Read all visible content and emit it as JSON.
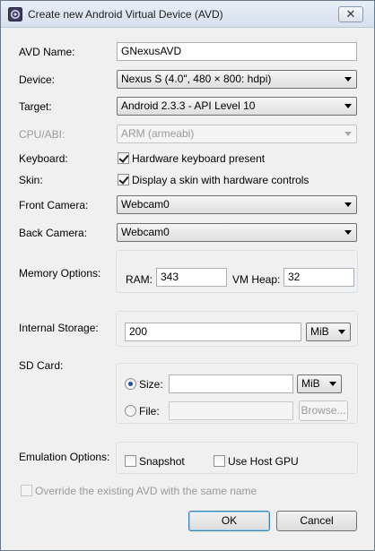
{
  "window": {
    "title": "Create new Android Virtual Device (AVD)",
    "close_symbol": "✕"
  },
  "form": {
    "avd_name": {
      "label": "AVD Name:",
      "value": "GNexusAVD"
    },
    "device": {
      "label": "Device:",
      "value": "Nexus S (4.0\", 480 × 800: hdpi)"
    },
    "target": {
      "label": "Target:",
      "value": "Android 2.3.3 - API Level 10"
    },
    "cpu_abi": {
      "label": "CPU/ABI:",
      "value": "ARM (armeabi)",
      "enabled": false
    },
    "keyboard": {
      "label": "Keyboard:",
      "checkbox_label": "Hardware keyboard present",
      "checked": true
    },
    "skin": {
      "label": "Skin:",
      "checkbox_label": "Display a skin with hardware controls",
      "checked": true
    },
    "front_camera": {
      "label": "Front Camera:",
      "value": "Webcam0"
    },
    "back_camera": {
      "label": "Back Camera:",
      "value": "Webcam0"
    },
    "memory": {
      "label": "Memory Options:",
      "ram_label": "RAM:",
      "ram_value": "343",
      "heap_label": "VM Heap:",
      "heap_value": "32"
    },
    "internal_storage": {
      "label": "Internal Storage:",
      "value": "200",
      "unit": "MiB"
    },
    "sd_card": {
      "label": "SD Card:",
      "size_label": "Size:",
      "size_value": "",
      "size_unit": "MiB",
      "size_selected": true,
      "file_label": "File:",
      "file_value": "",
      "browse_label": "Browse..."
    },
    "emulation": {
      "label": "Emulation Options:",
      "snapshot_label": "Snapshot",
      "snapshot_checked": false,
      "host_gpu_label": "Use Host GPU",
      "host_gpu_checked": false
    },
    "override": {
      "label": "Override the existing AVD with the same name",
      "checked": false,
      "enabled": false
    }
  },
  "buttons": {
    "ok": "OK",
    "cancel": "Cancel"
  }
}
